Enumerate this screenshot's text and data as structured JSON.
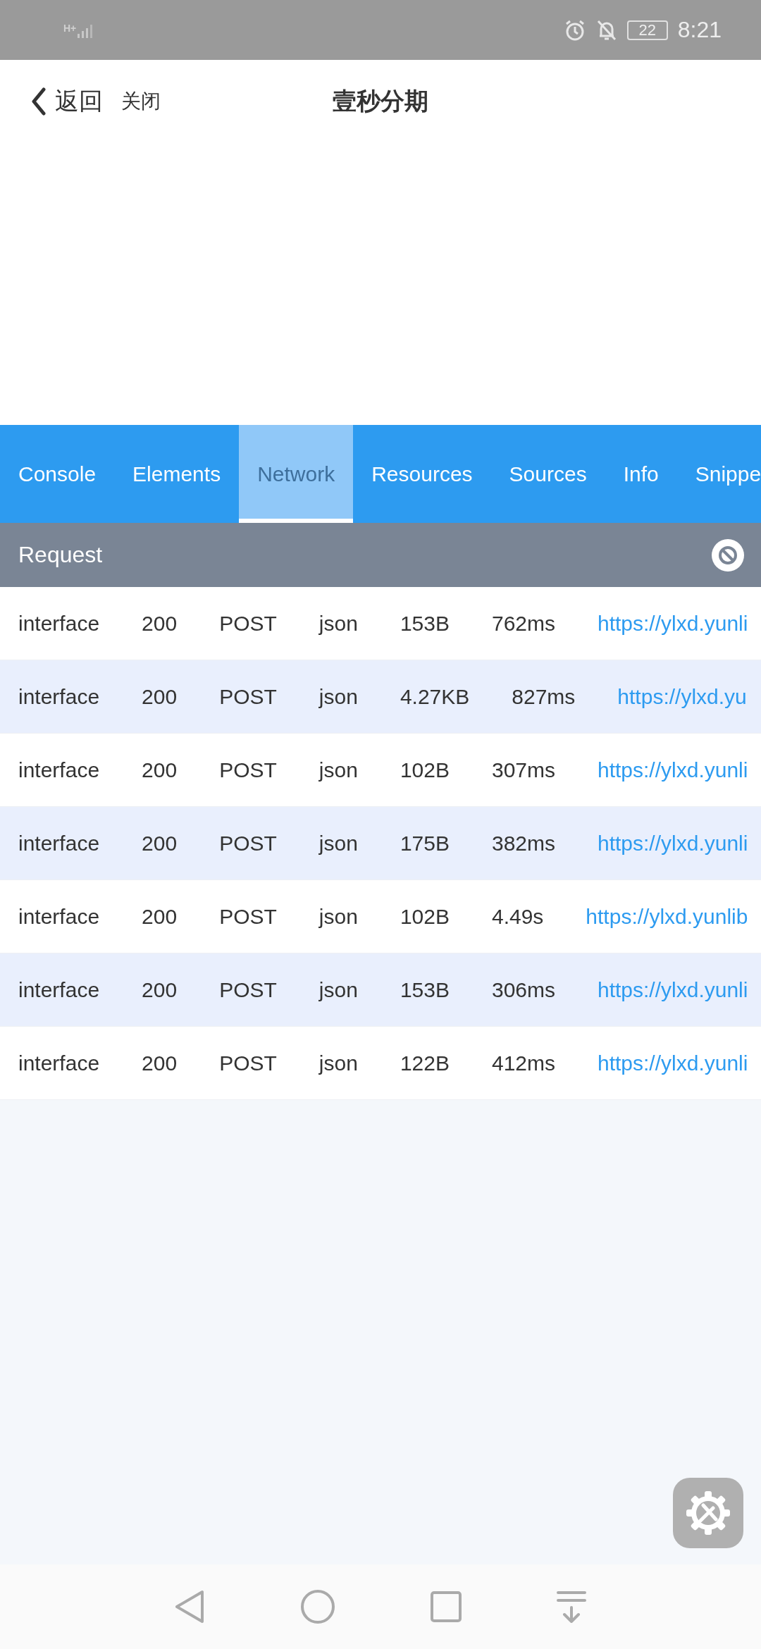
{
  "status_bar": {
    "network": "H+",
    "battery": "22",
    "time": "8:21"
  },
  "header": {
    "back": "返回",
    "close": "关闭",
    "title": "壹秒分期"
  },
  "devtools": {
    "tabs": [
      {
        "label": "Console",
        "selected": false
      },
      {
        "label": "Elements",
        "selected": false
      },
      {
        "label": "Network",
        "selected": true
      },
      {
        "label": "Resources",
        "selected": false
      },
      {
        "label": "Sources",
        "selected": false
      },
      {
        "label": "Info",
        "selected": false
      },
      {
        "label": "Snippe",
        "selected": false
      }
    ],
    "panel_title": "Request",
    "requests": [
      {
        "type": "interface",
        "status": "200",
        "method": "POST",
        "format": "json",
        "size": "153B",
        "time": "762ms",
        "url": "https://ylxd.yunli"
      },
      {
        "type": "interface",
        "status": "200",
        "method": "POST",
        "format": "json",
        "size": "4.27KB",
        "time": "827ms",
        "url": "https://ylxd.yu"
      },
      {
        "type": "interface",
        "status": "200",
        "method": "POST",
        "format": "json",
        "size": "102B",
        "time": "307ms",
        "url": "https://ylxd.yunli"
      },
      {
        "type": "interface",
        "status": "200",
        "method": "POST",
        "format": "json",
        "size": "175B",
        "time": "382ms",
        "url": "https://ylxd.yunli"
      },
      {
        "type": "interface",
        "status": "200",
        "method": "POST",
        "format": "json",
        "size": "102B",
        "time": "4.49s",
        "url": "https://ylxd.yunlib"
      },
      {
        "type": "interface",
        "status": "200",
        "method": "POST",
        "format": "json",
        "size": "153B",
        "time": "306ms",
        "url": "https://ylxd.yunli"
      },
      {
        "type": "interface",
        "status": "200",
        "method": "POST",
        "format": "json",
        "size": "122B",
        "time": "412ms",
        "url": "https://ylxd.yunli"
      }
    ]
  }
}
